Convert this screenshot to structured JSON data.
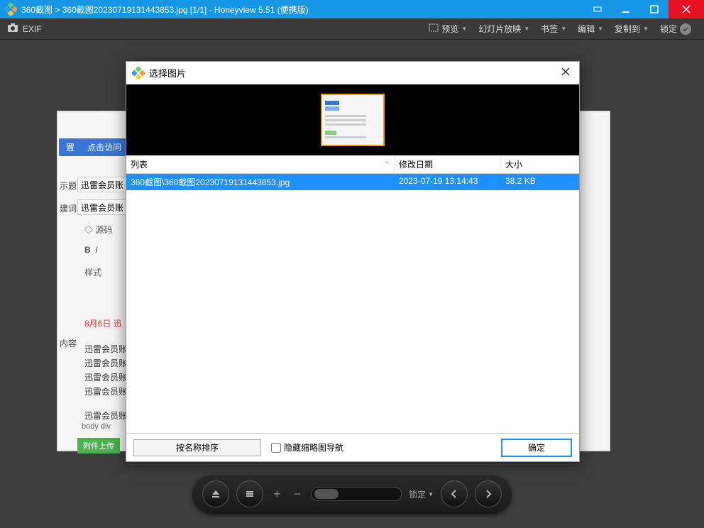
{
  "titlebar": {
    "path_prefix": "360截图",
    "sep": " > ",
    "filename": "360截图20230719131443853.jpg",
    "index": "[1/1]",
    "app": "Honeyview 5.51 (便携版)"
  },
  "toolbar": {
    "exif": "EXIF",
    "preview": "预览",
    "slideshow": "幻灯片放映",
    "bookmark": "书签",
    "edit": "编辑",
    "copyto": "复制到",
    "lock": "锁定"
  },
  "bgdoc": {
    "btn1": "置",
    "btn2": "点击访问",
    "label_title": "示题",
    "label_kw": "建词",
    "label_content": "内容",
    "inp_title": "迅雷会员账号",
    "inp_kw": "迅雷会员账号",
    "source": "源码",
    "style": "样式",
    "red_line": "8月6日 迅",
    "acct": "迅雷会员账",
    "tags": "body   div",
    "attach": "附件上传"
  },
  "dialog": {
    "title": "选择图片",
    "col_name": "列表",
    "col_date": "修改日期",
    "col_size": "大小",
    "row": {
      "name": "360截图\\360截图20230719131443853.jpg",
      "date": "2023-07-19 13:14:43",
      "size": "38.2 KB"
    },
    "sort_btn": "按名称排序",
    "hide_thumb": "隐藏缩略图导航",
    "ok": "确定"
  },
  "pill": {
    "lock": "锁定"
  }
}
